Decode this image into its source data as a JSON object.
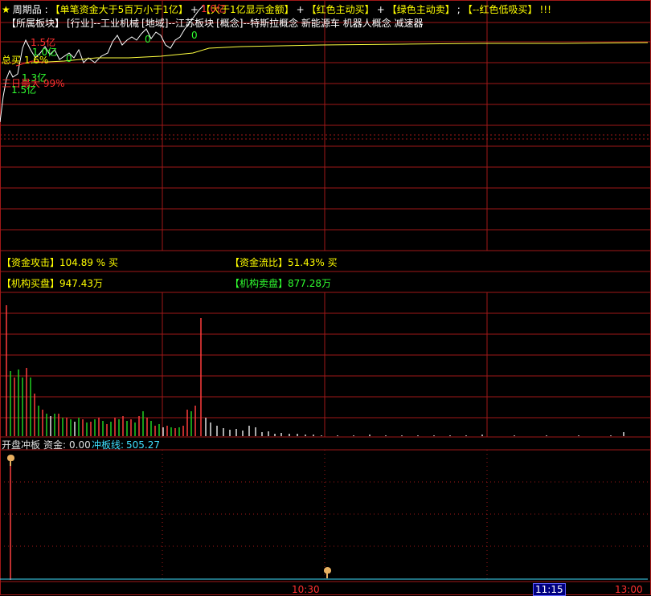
{
  "header": {
    "line1": [
      {
        "text": "★",
        "color": "#ffff00"
      },
      {
        "text": "周期品 :",
        "color": "#ffffff"
      },
      {
        "text": "【单笔资金大于5百万小于1亿】",
        "color": "#ffff00"
      },
      {
        "text": "+",
        "color": "#ffffff"
      },
      {
        "text": "【大于1亿显示金额】",
        "color": "#ffff00"
      },
      {
        "text": "+",
        "color": "#ffffff"
      },
      {
        "text": "【红色主动买】",
        "color": "#ffff00"
      },
      {
        "text": "+",
        "color": "#ffffff"
      },
      {
        "text": "【绿色主动卖】",
        "color": "#ffff00"
      },
      {
        "text": ";",
        "color": "#ffffff"
      },
      {
        "text": "【--红色低吸买】",
        "color": "#ffff00"
      },
      {
        "text": "!!!",
        "color": "#ffff00"
      }
    ],
    "line2": [
      {
        "text": "【所属板块】",
        "color": "#ffffff"
      },
      {
        "text": "[行业]--工业机械",
        "color": "#ffffff"
      },
      {
        "text": "[地域]--江苏板块",
        "color": "#ffffff"
      },
      {
        "text": "[概念]--特斯拉概念 新能源车 机器人概念 减速器",
        "color": "#ffffff"
      }
    ]
  },
  "chart_annotations": [
    {
      "text": "1.5亿",
      "color": "#ff3030"
    },
    {
      "text": "1.0亿",
      "color": "#30ff30"
    },
    {
      "text": "总买 1.6%",
      "color": "#ffff00"
    },
    {
      "text": "1.3亿",
      "color": "#30ff30"
    },
    {
      "text": "三日最大 99%",
      "color": "#ff3030"
    },
    {
      "text": "1.5亿",
      "color": "#30ff30"
    },
    {
      "text": "0",
      "color": "#30ff30"
    },
    {
      "text": "0",
      "color": "#30ff30"
    },
    {
      "text": "0",
      "color": "#30ff30"
    },
    {
      "text": "1.0亿",
      "color": "#ff3030"
    }
  ],
  "indicators": {
    "attack_label": "【资金攻击】",
    "attack_value": "104.89 % 买",
    "flow_label": "【资金流比】",
    "flow_value": "51.43% 买",
    "inst_buy_label": "【机构买盘】",
    "inst_buy_value": "947.43万",
    "inst_sell_label": "【机构卖盘】",
    "inst_sell_value": "877.28万"
  },
  "bottom_panel": {
    "title": "开盘冲板",
    "fund_label": "资金:",
    "fund_value": "0.00",
    "line_label": "冲板线:",
    "line_value": "505.27"
  },
  "time_axis": {
    "t1": "10:30",
    "t2": "11:15",
    "t3": "13:00"
  },
  "colors": {
    "grid": "#a01818",
    "up": "#ff3c3c",
    "down": "#20d020",
    "flat": "#e0e0e0",
    "price": "#ffffff",
    "avg": "#ffff40",
    "cyan": "#40e0ff",
    "yellow": "#ffff00"
  }
}
